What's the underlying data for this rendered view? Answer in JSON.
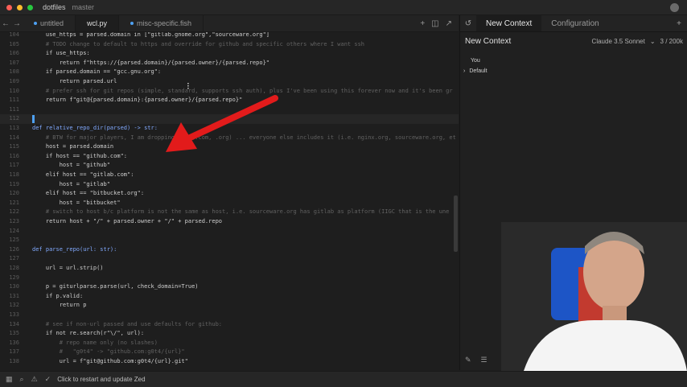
{
  "titlebar": {
    "project": "dotfiles",
    "branch": "master"
  },
  "tabs": [
    {
      "label": "untitled",
      "modified": true
    },
    {
      "label": "wcl.py",
      "modified": false
    },
    {
      "label": "misc-specific.fish",
      "modified": true
    }
  ],
  "icons": {
    "back": "arrow-left-icon",
    "forward": "arrow-right-icon",
    "add": "plus-icon",
    "split": "split-icon",
    "expand": "expand-icon",
    "history": "history-icon",
    "chevron": "chevron-right-icon",
    "pen": "pen-icon",
    "book": "book-icon"
  },
  "code_lines": [
    {
      "n": "104",
      "text": "    use_https = parsed.domain in [\"gitlab.gnome.org\",\"sourceware.org\"]"
    },
    {
      "n": "105",
      "text": "    # TODO change to default to https and override for github and specific others where I want ssh"
    },
    {
      "n": "106",
      "text": "    if use_https:"
    },
    {
      "n": "107",
      "text": "        return f\"https://{parsed.domain}/{parsed.owner}/{parsed.repo}\""
    },
    {
      "n": "108",
      "text": "    if parsed.domain == \"gcc.gnu.org\":"
    },
    {
      "n": "109",
      "text": "        return parsed.url"
    },
    {
      "n": "110",
      "text": "    # prefer ssh for git repos (simple, standard, supports ssh auth), plus I've been using this forever now and it's been gr"
    },
    {
      "n": "111",
      "text": "    return f\"git@{parsed.domain}:{parsed.owner}/{parsed.repo}\""
    },
    {
      "n": "111b",
      "text": ""
    },
    {
      "n": "112",
      "text": ""
    },
    {
      "n": "113",
      "text": "def relative_repo_dir(parsed) -> str:"
    },
    {
      "n": "114",
      "text": "    # BTW for major players, I am dropping TLD (.com, .org) ... everyone else includes it (i.e. nginx.org, sourceware.org, et"
    },
    {
      "n": "115",
      "text": "    host = parsed.domain"
    },
    {
      "n": "116",
      "text": "    if host == \"github.com\":"
    },
    {
      "n": "117",
      "text": "        host = \"github\""
    },
    {
      "n": "118",
      "text": "    elif host == \"gitlab.com\":"
    },
    {
      "n": "119",
      "text": "        host = \"gitlab\""
    },
    {
      "n": "120",
      "text": "    elif host == \"bitbucket.org\":"
    },
    {
      "n": "121",
      "text": "        host = \"bitbucket\""
    },
    {
      "n": "122",
      "text": "    # switch to host b/c platform is not the same as host, i.e. sourceware.org has gitlab as platform (IIGC that is the une"
    },
    {
      "n": "123",
      "text": "    return host + \"/\" + parsed.owner + \"/\" + parsed.repo"
    },
    {
      "n": "124",
      "text": ""
    },
    {
      "n": "125",
      "text": ""
    },
    {
      "n": "126",
      "text": "def parse_repo(url: str):"
    },
    {
      "n": "127",
      "text": ""
    },
    {
      "n": "128",
      "text": "    url = url.strip()"
    },
    {
      "n": "129",
      "text": ""
    },
    {
      "n": "130",
      "text": "    p = giturlparse.parse(url, check_domain=True)"
    },
    {
      "n": "131",
      "text": "    if p.valid:"
    },
    {
      "n": "132",
      "text": "        return p"
    },
    {
      "n": "133",
      "text": ""
    },
    {
      "n": "134",
      "text": "    # see if non-url passed and use defaults for github:"
    },
    {
      "n": "135",
      "text": "    if not re.search(r\"\\/\", url):"
    },
    {
      "n": "136",
      "text": "        # repo name only (no slashes)"
    },
    {
      "n": "137",
      "text": "        #   \"g0t4\" -> \"github.com:g0t4/{url}\""
    },
    {
      "n": "138",
      "text": "        url = f\"git@github.com:g0t4/{url}.git\""
    }
  ],
  "assistant": {
    "tab_active": "New Context",
    "tab_other": "Configuration",
    "header": "New Context",
    "model": "Claude 3.5 Sonnet",
    "tokens": "3 / 200k",
    "role": "You",
    "section": "Default"
  },
  "status": {
    "message": "Click to restart and update Zed"
  }
}
